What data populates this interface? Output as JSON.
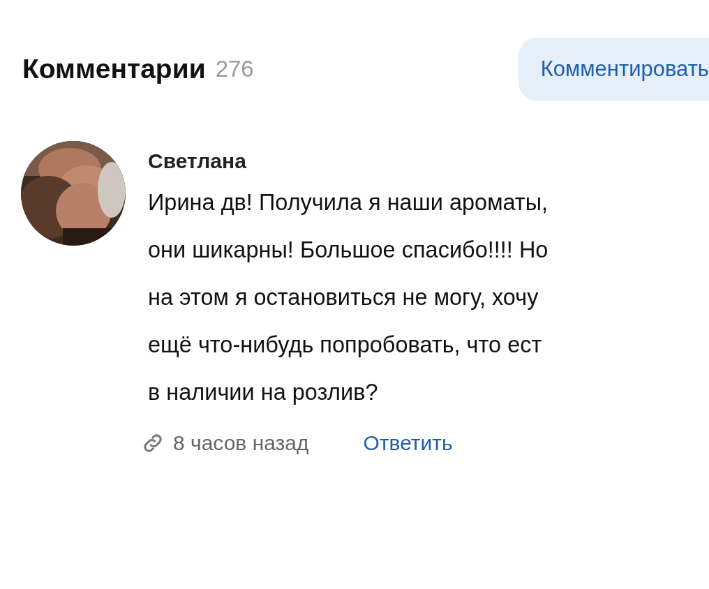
{
  "header": {
    "title": "Комментарии",
    "count": "276",
    "button": "Комментировать"
  },
  "comments": [
    {
      "author": "Светлана",
      "lines": [
        "Ирина дв! Получила я наши ароматы,",
        "они шикарны! Большое спасибо!!!! Но",
        "на этом я остановиться не могу, хочу",
        "ещё что-нибудь попробовать, что ест",
        "в наличии на розлив?"
      ],
      "time": "8 часов назад",
      "reply": "Ответить"
    }
  ]
}
